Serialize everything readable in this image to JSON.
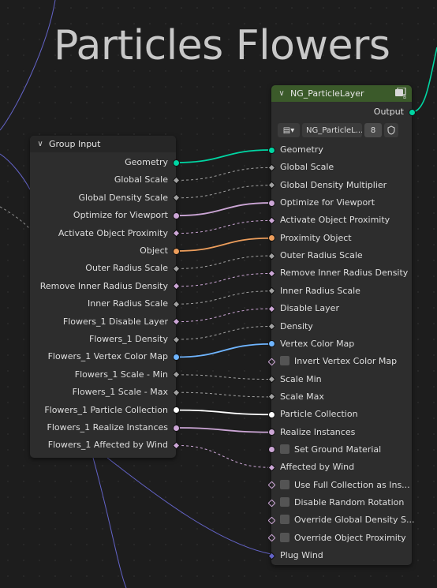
{
  "frame": {
    "title": "Particles Flowers"
  },
  "group_input": {
    "title": "Group Input",
    "outputs": [
      {
        "label": "Geometry",
        "color": "#00d6a3",
        "shape": "circle"
      },
      {
        "label": "Global Scale",
        "color": "#a1a1a1",
        "shape": "diamond"
      },
      {
        "label": "Global Density Scale",
        "color": "#a1a1a1",
        "shape": "diamond"
      },
      {
        "label": "Optimize for Viewport",
        "color": "#cca6d6",
        "shape": "circle"
      },
      {
        "label": "Activate Object Proximity",
        "color": "#cca6d6",
        "shape": "diamond"
      },
      {
        "label": "Object",
        "color": "#ed9e5c",
        "shape": "circle"
      },
      {
        "label": "Outer Radius Scale",
        "color": "#a1a1a1",
        "shape": "diamond"
      },
      {
        "label": "Remove Inner Radius Density",
        "color": "#cca6d6",
        "shape": "diamond"
      },
      {
        "label": "Inner Radius Scale",
        "color": "#a1a1a1",
        "shape": "diamond"
      },
      {
        "label": "Flowers_1 Disable Layer",
        "color": "#cca6d6",
        "shape": "diamond"
      },
      {
        "label": "Flowers_1 Density",
        "color": "#a1a1a1",
        "shape": "diamond"
      },
      {
        "label": "Flowers_1 Vertex Color Map",
        "color": "#6fb5ff",
        "shape": "circle"
      },
      {
        "label": "Flowers_1 Scale - Min",
        "color": "#a1a1a1",
        "shape": "diamond"
      },
      {
        "label": "Flowers_1 Scale - Max",
        "color": "#a1a1a1",
        "shape": "diamond"
      },
      {
        "label": "Flowers_1 Particle Collection",
        "color": "#ffffff",
        "shape": "circle"
      },
      {
        "label": "Flowers_1 Realize Instances",
        "color": "#cca6d6",
        "shape": "circle"
      },
      {
        "label": "Flowers_1 Affected by Wind",
        "color": "#cca6d6",
        "shape": "diamond"
      }
    ]
  },
  "ng_node": {
    "title": "NG_ParticleLayer",
    "output_label": "Output",
    "datablock_name": "NG_ParticleL...",
    "user_count": "8",
    "inputs": [
      {
        "label": "Geometry",
        "color": "#00d6a3",
        "shape": "circle",
        "checkbox": false,
        "hollow": false
      },
      {
        "label": "Global Scale",
        "color": "#a1a1a1",
        "shape": "diamond",
        "checkbox": false,
        "hollow": false
      },
      {
        "label": "Global Density Multiplier",
        "color": "#a1a1a1",
        "shape": "diamond",
        "checkbox": false,
        "hollow": false
      },
      {
        "label": "Optimize for Viewport",
        "color": "#cca6d6",
        "shape": "circle",
        "checkbox": false,
        "hollow": false
      },
      {
        "label": "Activate Object Proximity",
        "color": "#cca6d6",
        "shape": "diamond",
        "checkbox": false,
        "hollow": false
      },
      {
        "label": "Proximity Object",
        "color": "#ed9e5c",
        "shape": "circle",
        "checkbox": false,
        "hollow": false
      },
      {
        "label": "Outer Radius Scale",
        "color": "#a1a1a1",
        "shape": "diamond",
        "checkbox": false,
        "hollow": false
      },
      {
        "label": "Remove Inner Radius Density",
        "color": "#cca6d6",
        "shape": "diamond",
        "checkbox": false,
        "hollow": false
      },
      {
        "label": "Inner Radius Scale",
        "color": "#a1a1a1",
        "shape": "diamond",
        "checkbox": false,
        "hollow": false
      },
      {
        "label": "Disable Layer",
        "color": "#cca6d6",
        "shape": "diamond",
        "checkbox": false,
        "hollow": false
      },
      {
        "label": "Density",
        "color": "#a1a1a1",
        "shape": "diamond",
        "checkbox": false,
        "hollow": false
      },
      {
        "label": "Vertex Color Map",
        "color": "#6fb5ff",
        "shape": "circle",
        "checkbox": false,
        "hollow": false
      },
      {
        "label": "Invert Vertex Color Map",
        "color": "#cca6d6",
        "shape": "diamond",
        "checkbox": true,
        "hollow": true
      },
      {
        "label": "Scale Min",
        "color": "#a1a1a1",
        "shape": "diamond",
        "checkbox": false,
        "hollow": false
      },
      {
        "label": "Scale Max",
        "color": "#a1a1a1",
        "shape": "diamond",
        "checkbox": false,
        "hollow": false
      },
      {
        "label": "Particle Collection",
        "color": "#ffffff",
        "shape": "circle",
        "checkbox": false,
        "hollow": false
      },
      {
        "label": "Realize Instances",
        "color": "#cca6d6",
        "shape": "circle",
        "checkbox": false,
        "hollow": false
      },
      {
        "label": "Set Ground Material",
        "color": "#cca6d6",
        "shape": "circle",
        "checkbox": true,
        "hollow": false
      },
      {
        "label": "Affected by Wind",
        "color": "#cca6d6",
        "shape": "diamond",
        "checkbox": false,
        "hollow": false
      },
      {
        "label": "Use Full Collection as Ins...",
        "color": "#cca6d6",
        "shape": "diamond",
        "checkbox": true,
        "hollow": true
      },
      {
        "label": "Disable Random Rotation",
        "color": "#cca6d6",
        "shape": "diamond",
        "checkbox": true,
        "hollow": true
      },
      {
        "label": "Override Global Density S...",
        "color": "#cca6d6",
        "shape": "diamond",
        "checkbox": true,
        "hollow": true
      },
      {
        "label": "Override Object Proximity",
        "color": "#cca6d6",
        "shape": "diamond",
        "checkbox": true,
        "hollow": true
      },
      {
        "label": "Plug Wind",
        "color": "#6363c7",
        "shape": "diamond",
        "checkbox": false,
        "hollow": false
      }
    ]
  },
  "links": [
    {
      "from": 0,
      "to": 0,
      "color": "#00d6a3",
      "dashed": false
    },
    {
      "from": 1,
      "to": 1,
      "color": "#a1a1a1",
      "dashed": true
    },
    {
      "from": 2,
      "to": 2,
      "color": "#a1a1a1",
      "dashed": true
    },
    {
      "from": 3,
      "to": 3,
      "color": "#cca6d6",
      "dashed": false
    },
    {
      "from": 4,
      "to": 4,
      "color": "#cca6d6",
      "dashed": true
    },
    {
      "from": 5,
      "to": 5,
      "color": "#ed9e5c",
      "dashed": false
    },
    {
      "from": 6,
      "to": 6,
      "color": "#a1a1a1",
      "dashed": true
    },
    {
      "from": 7,
      "to": 7,
      "color": "#cca6d6",
      "dashed": true
    },
    {
      "from": 8,
      "to": 8,
      "color": "#a1a1a1",
      "dashed": true
    },
    {
      "from": 9,
      "to": 9,
      "color": "#cca6d6",
      "dashed": true
    },
    {
      "from": 10,
      "to": 10,
      "color": "#a1a1a1",
      "dashed": true
    },
    {
      "from": 11,
      "to": 11,
      "color": "#6fb5ff",
      "dashed": false
    },
    {
      "from": 12,
      "to": 13,
      "color": "#a1a1a1",
      "dashed": true
    },
    {
      "from": 13,
      "to": 14,
      "color": "#a1a1a1",
      "dashed": true
    },
    {
      "from": 14,
      "to": 15,
      "color": "#ffffff",
      "dashed": false
    },
    {
      "from": 15,
      "to": 16,
      "color": "#cca6d6",
      "dashed": false
    },
    {
      "from": 16,
      "to": 18,
      "color": "#cca6d6",
      "dashed": true
    }
  ],
  "colors": {
    "ng_header": "#3b5a2a",
    "group_header": "#262626",
    "node_body": "#2d2d2d"
  }
}
